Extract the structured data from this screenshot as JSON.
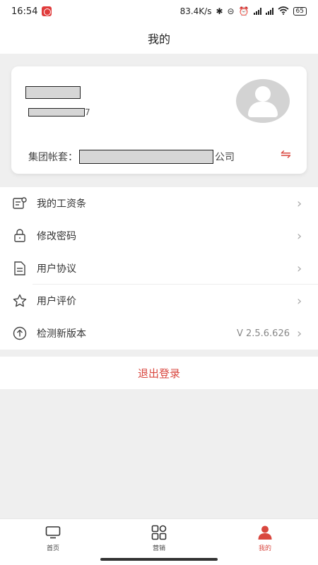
{
  "status": {
    "time": "16:54",
    "network_speed": "83.4K/s",
    "battery": "65"
  },
  "header": {
    "title": "我的"
  },
  "profile": {
    "phone_suffix": "7",
    "group_label": "集团帐套：",
    "group_suffix": "公司",
    "switch_icon": "⇋"
  },
  "menu": {
    "items": [
      {
        "label": "我的工资条",
        "icon": "payslip-icon"
      },
      {
        "label": "修改密码",
        "icon": "lock-icon"
      },
      {
        "label": "用户协议",
        "icon": "document-icon"
      },
      {
        "label": "用户评价",
        "icon": "star-icon"
      },
      {
        "label": "检测新版本",
        "icon": "upload-icon",
        "value": "V 2.5.6.626"
      }
    ],
    "chevron": "›"
  },
  "logout": {
    "label": "退出登录"
  },
  "tabs": [
    {
      "label": "首页",
      "icon": "monitor-icon"
    },
    {
      "label": "营销",
      "icon": "grid-icon"
    },
    {
      "label": "我的",
      "icon": "user-icon",
      "active": true
    }
  ],
  "colors": {
    "accent": "#d9473f",
    "background": "#efefef"
  }
}
